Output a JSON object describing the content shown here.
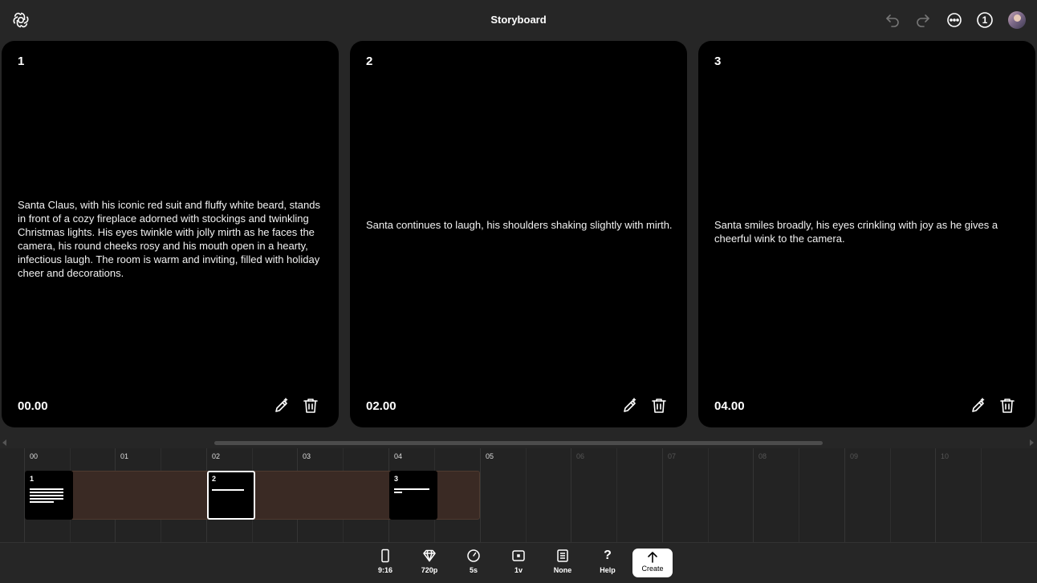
{
  "header": {
    "title": "Storyboard",
    "icons": [
      "openai-logo-icon",
      "undo-icon",
      "redo-icon",
      "more-icon",
      "count-badge",
      "avatar"
    ],
    "count_badge": "1"
  },
  "cards": [
    {
      "number": "1",
      "text": "Santa Claus, with his iconic red suit and fluffy white beard, stands in front of a cozy fireplace adorned with stockings and twinkling Christmas lights. His eyes twinkle with jolly mirth as he faces the camera, his round cheeks rosy and his mouth open in a hearty, infectious laugh. The room is warm and inviting, filled with holiday cheer and decorations.",
      "time": "00.00"
    },
    {
      "number": "2",
      "text": "Santa continues to laugh, his shoulders shaking slightly with mirth.",
      "time": "02.00"
    },
    {
      "number": "3",
      "text": "Santa smiles broadly, his eyes crinkling with joy as he gives a cheerful wink to the camera.",
      "time": "04.00"
    }
  ],
  "timeline": {
    "ticks": [
      "00",
      "01",
      "02",
      "03",
      "04",
      "05",
      "06",
      "07",
      "08",
      "09",
      "10"
    ],
    "clips": [
      {
        "number": "1"
      },
      {
        "number": "2"
      },
      {
        "number": "3"
      }
    ]
  },
  "toolbar": {
    "items": [
      {
        "label": "9:16",
        "icon": "phone-icon"
      },
      {
        "label": "720p",
        "icon": "diamond-icon"
      },
      {
        "label": "5s",
        "icon": "clock-icon"
      },
      {
        "label": "1v",
        "icon": "variation-icon"
      },
      {
        "label": "None",
        "icon": "document-icon"
      },
      {
        "label": "Help",
        "icon": "help-icon"
      }
    ],
    "create_label": "Create"
  }
}
